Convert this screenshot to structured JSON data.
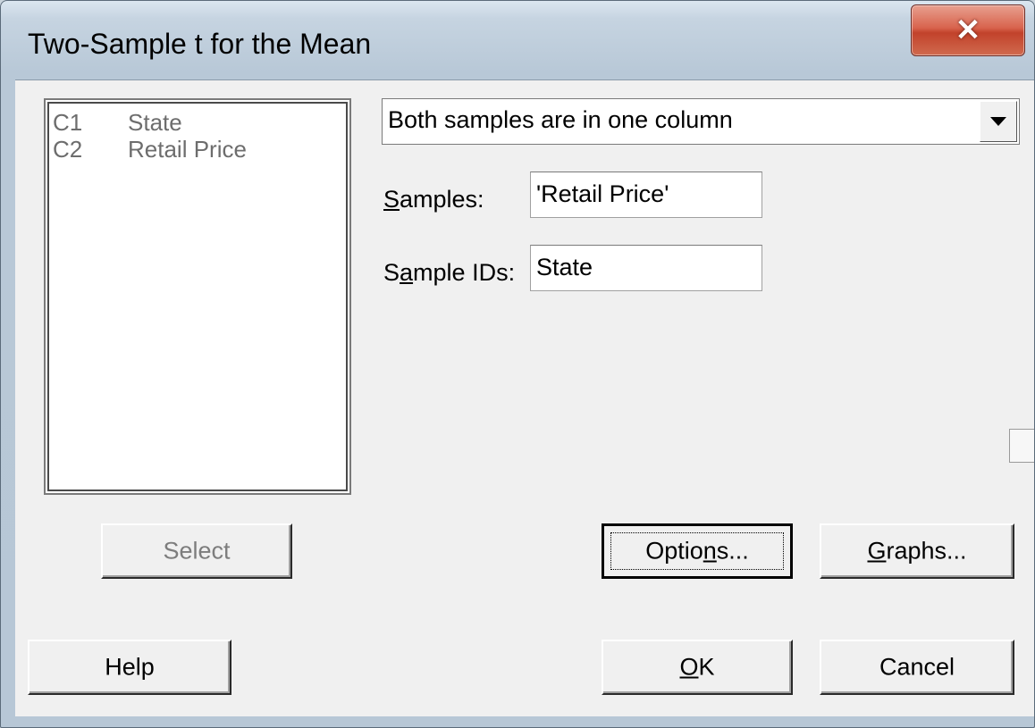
{
  "window": {
    "title": "Two-Sample t for the Mean",
    "close_icon": "close-icon"
  },
  "variables_list": [
    {
      "id": "C1",
      "name": "State"
    },
    {
      "id": "C2",
      "name": "Retail Price"
    }
  ],
  "mode_dropdown": {
    "selected": "Both samples are in one column"
  },
  "fields": {
    "samples_label": "Samples:",
    "samples_value": "'Retail Price'",
    "sample_ids_label": "Sample IDs:",
    "sample_ids_value": "State"
  },
  "buttons": {
    "select": "Select",
    "options": "Options...",
    "graphs": "Graphs...",
    "help": "Help",
    "ok": "OK",
    "cancel": "Cancel"
  },
  "colors": {
    "close_button": "#c2422b",
    "dialog_bg": "#f0f0f0",
    "disabled_text": "#7d7d7d"
  }
}
